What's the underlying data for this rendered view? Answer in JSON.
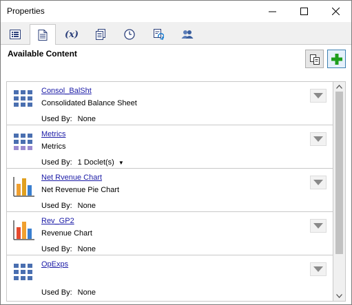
{
  "window": {
    "title": "Properties"
  },
  "tabs": [
    {
      "icon": "list-details-icon",
      "active": false
    },
    {
      "icon": "document-icon",
      "active": true
    },
    {
      "icon": "variable-fx-icon",
      "label": "(x)",
      "active": false
    },
    {
      "icon": "report-pages-icon",
      "active": false
    },
    {
      "icon": "clock-icon",
      "active": false
    },
    {
      "icon": "refresh-document-icon",
      "active": false
    },
    {
      "icon": "users-icon",
      "active": false
    }
  ],
  "content": {
    "section_title": "Available Content",
    "used_by_label": "Used By:",
    "items": [
      {
        "name": "Consol_BalSht",
        "description": "Consolidated Balance Sheet",
        "used_by": "None",
        "icon": "grid-icon",
        "has_dropdown": false
      },
      {
        "name": "Metrics",
        "description": "Metrics",
        "used_by": "1 Doclet(s)",
        "icon": "grid-icon",
        "has_dropdown": true
      },
      {
        "name": "Net Rvenue Chart",
        "description": "Net Revenue Pie Chart",
        "used_by": "None",
        "icon": "bar-chart-icon",
        "has_dropdown": false
      },
      {
        "name": "Rev_GP2",
        "description": "Revenue Chart",
        "used_by": "None",
        "icon": "bar-chart-icon",
        "has_dropdown": false
      },
      {
        "name": "OpExps",
        "description": "",
        "used_by": "None",
        "icon": "grid-icon",
        "has_dropdown": false
      }
    ]
  },
  "colors": {
    "link": "#1a1aa6",
    "add_button_green": "#1e9e1e",
    "grid_blue": "#4a6fb0"
  }
}
